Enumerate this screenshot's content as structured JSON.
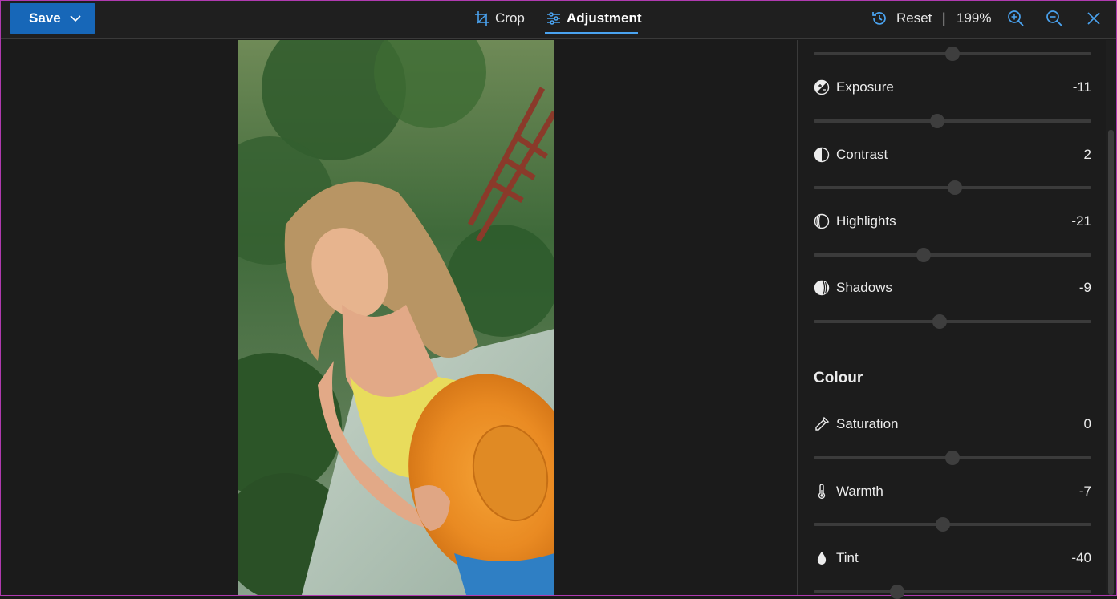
{
  "toolbar": {
    "save_label": "Save",
    "crop_label": "Crop",
    "adjustment_label": "Adjustment",
    "reset_label": "Reset",
    "separator": "|",
    "zoom_level": "199%"
  },
  "panel": {
    "top_slider": {
      "level": 0.5
    },
    "adjustments": [
      {
        "label": "Exposure",
        "value": "-11",
        "icon": "exposure-icon",
        "level": 0.445
      },
      {
        "label": "Contrast",
        "value": "2",
        "icon": "contrast-icon",
        "level": 0.51
      },
      {
        "label": "Highlights",
        "value": "-21",
        "icon": "highlights-icon",
        "level": 0.395
      },
      {
        "label": "Shadows",
        "value": "-9",
        "icon": "shadows-icon",
        "level": 0.455
      }
    ],
    "colour_title": "Colour",
    "colour": [
      {
        "label": "Saturation",
        "value": "0",
        "icon": "eyedropper-icon",
        "level": 0.5
      },
      {
        "label": "Warmth",
        "value": "-7",
        "icon": "thermometer-icon",
        "level": 0.465
      },
      {
        "label": "Tint",
        "value": "-40",
        "icon": "drop-icon",
        "level": 0.3
      }
    ]
  },
  "colors": {
    "accent": "#1767b8",
    "tab_underline": "#4aa3f0",
    "icon_blue": "#4aa3f0"
  }
}
